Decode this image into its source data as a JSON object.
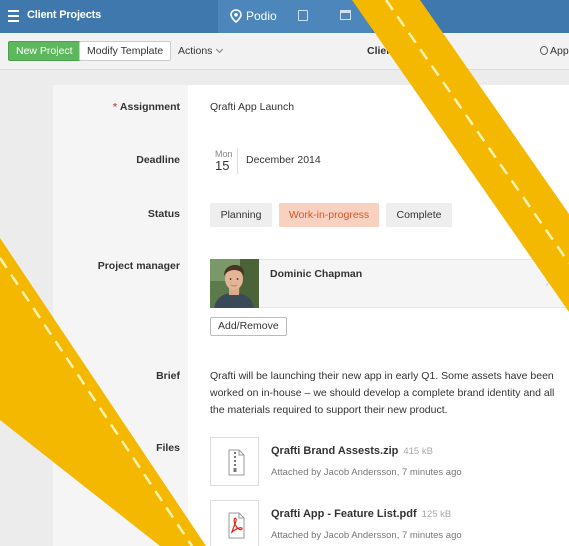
{
  "header": {
    "app_title": "Client Projects",
    "brand": "Podio"
  },
  "toolbar": {
    "new_label": "New Project",
    "modify_label": "Modify Template",
    "actions_label": "Actions",
    "client_label_cut": "Clien",
    "app_label_cut": "App"
  },
  "fields": {
    "assignment": {
      "label": "Assignment",
      "required": "*",
      "value": "Qrafti App Launch"
    },
    "deadline": {
      "label": "Deadline",
      "month": "Mon",
      "day": "15",
      "date": "December 2014"
    },
    "status": {
      "label": "Status",
      "options": [
        "Planning",
        "Work-in-progress",
        "Complete"
      ],
      "selected": "Work-in-progress"
    },
    "project_manager": {
      "label": "Project manager",
      "name": "Dominic Chapman",
      "button": "Add/Remove"
    },
    "brief": {
      "label": "Brief",
      "text": "Qrafti will be launching their new app in early Q1. Some assets have been worked on in-house – we should develop a complete brand identity and all the materials required to support their new product."
    },
    "files": {
      "label": "Files",
      "items": [
        {
          "name": "Qrafti Brand Assests.zip",
          "size": "415 kB",
          "meta": "Attached by Jacob Andersson, 7 minutes ago",
          "icon": "zip-file-icon"
        },
        {
          "name": "Qrafti App - Feature List.pdf",
          "size": "125 kB",
          "meta": "Attached by Jacob Andersson, 7 minutes ago",
          "icon": "pdf-file-icon"
        }
      ]
    }
  },
  "colors": {
    "header": "#3e78ac",
    "new_button": "#5cb85c",
    "status_active_bg": "#f9d1c1",
    "status_active_text": "#d9542b",
    "ribbon": "#f5b800",
    "required": "#d9534f"
  }
}
